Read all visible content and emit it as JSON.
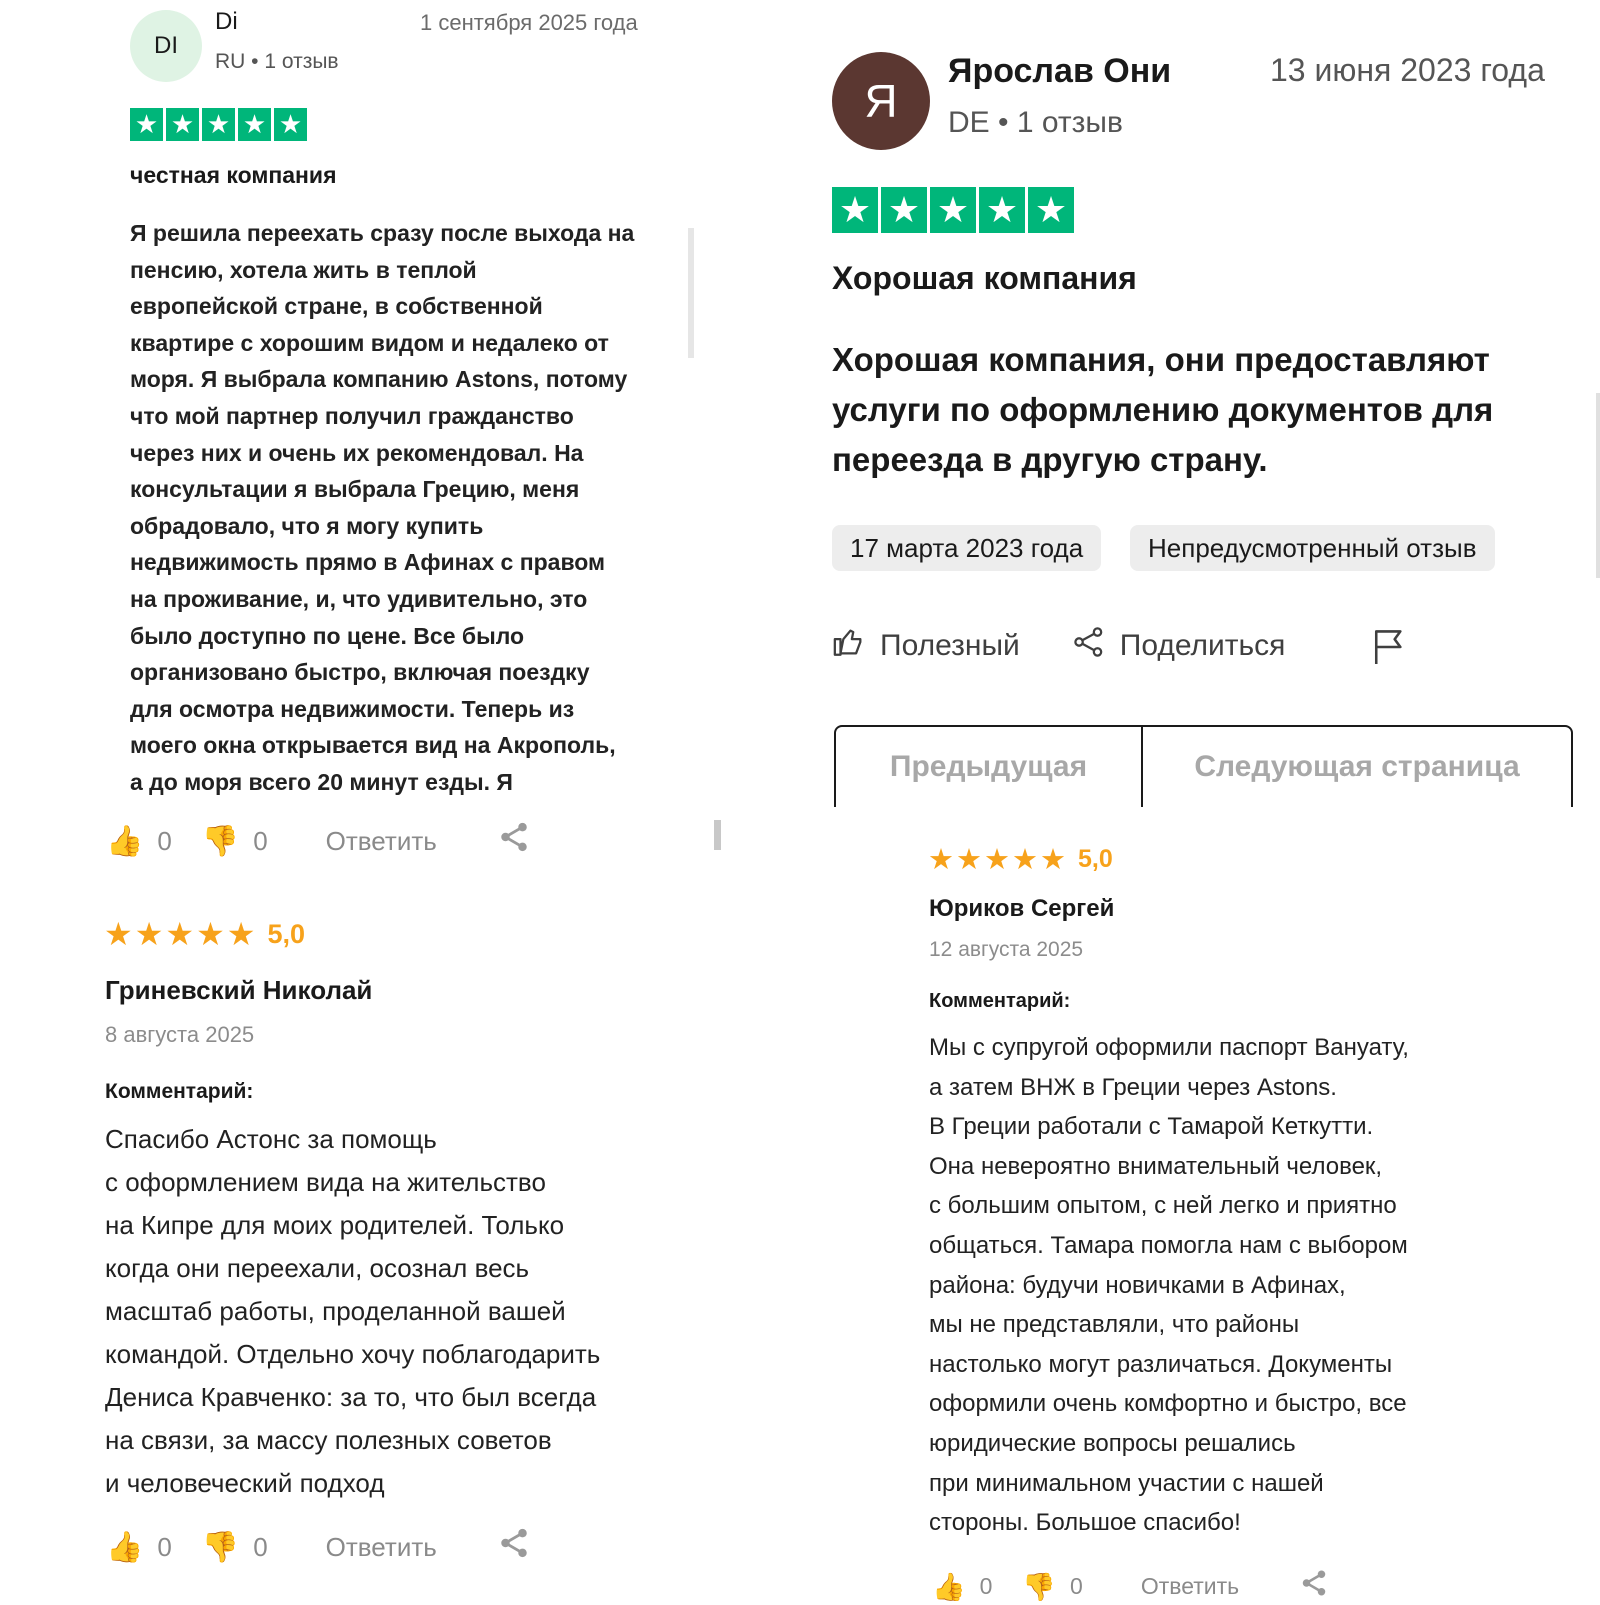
{
  "review_top_left": {
    "avatar_initials": "DI",
    "author": "Di",
    "meta": "RU • 1 отзыв",
    "date": "1 сентября 2025 года",
    "stars": 5,
    "title": "честная компания",
    "body": "Я решила переехать сразу после выхода на\nпенсию, хотела жить в теплой\nевропейской стране, в собственной\nквартире с хорошим видом и недалеко от\nморя. Я выбрала компанию Astons, потому\nчто мой партнер получил гражданство\nчерез них и очень их рекомендовал. На\nконсультации я выбрала Грецию, меня\nобрадовало, что я могу купить\nнедвижимость прямо в Афинах с правом\nна проживание, и, что удивительно, это\nбыло доступно по цене. Все было\nорганизовано быстро, включая поездку\nдля осмотра недвижимости. Теперь из\nмоего окна открывается вид на Акрополь,\nа до моря всего 20 минут езды. Я",
    "likes": "0",
    "dislikes": "0",
    "reply_label": "Ответить",
    "icons": [
      "thumbs-up-icon",
      "thumbs-down-icon",
      "share-icon"
    ]
  },
  "review_top_right": {
    "avatar_initials": "Я",
    "author": "Ярослав Они",
    "meta": "DE • 1 отзыв",
    "date": "13 июня 2023 года",
    "stars": 5,
    "title": "Хорошая компания",
    "body": "Хорошая компания, они предоставляют услуги по оформлению документов для переезда в другую страну.",
    "experience_date": "17 марта 2023 года",
    "review_type": "Непредусмотренный отзыв",
    "helpful_label": "Полезный",
    "share_label": "Поделиться",
    "icons": [
      "thumbs-up-outline-icon",
      "share-icon",
      "flag-icon"
    ]
  },
  "pagination": {
    "prev_label": "Предыдущая",
    "next_label": "Следующая страница"
  },
  "review_bottom_left": {
    "stars": 5,
    "rating": "5,0",
    "author": "Гриневский Николай",
    "date": "8 августа 2025",
    "comment_label": "Комментарий:",
    "body": "Спасибо Астонс за помощь\nс оформлением вида на жительство\nна Кипре для моих родителей. Только\nкогда они переехали, осознал весь\nмасштаб работы, проделанной вашей\nкомандой. Отдельно хочу поблагодарить\nДениса Кравченко: за то, что был всегда\nна связи, за массу полезных советов\nи человеческий подход",
    "likes": "0",
    "dislikes": "0",
    "reply_label": "Ответить"
  },
  "review_bottom_right": {
    "stars": 5,
    "rating": "5,0",
    "author": "Юриков Сергей",
    "date": "12 августа 2025",
    "comment_label": "Комментарий:",
    "body": "Мы с супругой оформили паспорт Вануату,\nа затем ВНЖ в Греции через Astons.\nВ Греции работали с Тамарой Кеткутти.\nОна невероятно внимательный человек,\nс большим опытом, с ней легко и приятно\nобщаться. Тамара помогла нам с выбором\nрайона: будучи новичками в Афинах,\nмы не представляли, что районы\nнастолько могут различаться. Документы\nоформили очень комфортно и быстро, все\nюридические вопросы решались\nпри минимальном участии с нашей\nстороны. Большое спасибо!",
    "likes": "0",
    "dislikes": "0",
    "reply_label": "Ответить"
  },
  "colors": {
    "trustpilot_green": "#00b67a",
    "gold_star": "#f7a21b",
    "avatar_di_bg": "#dff3e4",
    "avatar_ya_bg": "#5b3731"
  }
}
